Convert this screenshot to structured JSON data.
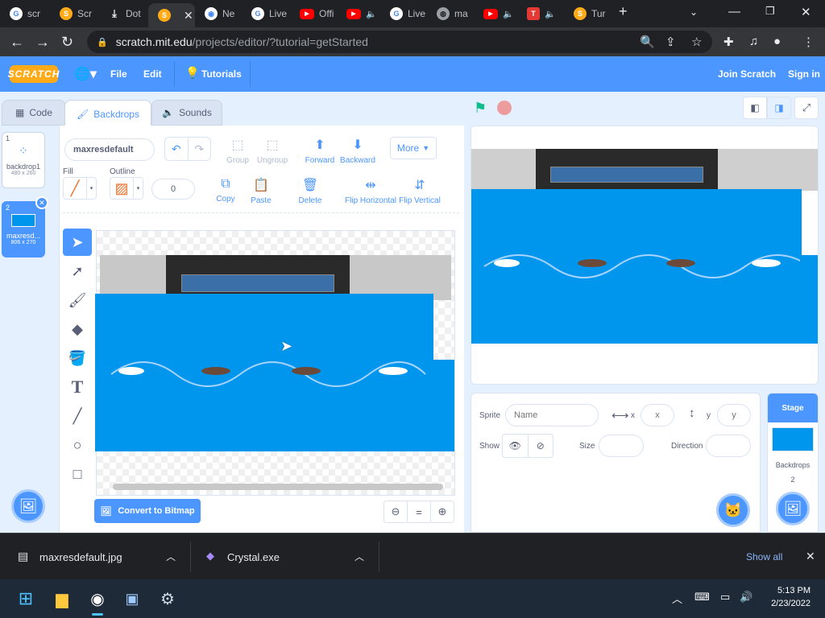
{
  "browser": {
    "tabs": [
      {
        "icon": "google-icon",
        "label": "scr"
      },
      {
        "icon": "scratch-icon",
        "label": "Scr"
      },
      {
        "icon": "download-icon",
        "label": "Dot"
      },
      {
        "icon": "scratch-icon",
        "label": "",
        "active": true
      },
      {
        "icon": "chrome-icon",
        "label": "Ne"
      },
      {
        "icon": "google-icon",
        "label": "Live"
      },
      {
        "icon": "youtube-icon",
        "label": "Offi"
      },
      {
        "icon": "youtube-icon",
        "label": ""
      },
      {
        "icon": "google-icon",
        "label": "Live"
      },
      {
        "icon": "globe-icon",
        "label": "ma"
      },
      {
        "icon": "youtube-icon",
        "label": ""
      },
      {
        "icon": "tool-icon",
        "label": ""
      },
      {
        "icon": "scratch-icon",
        "label": "Tur"
      }
    ],
    "url_host": "scratch.mit.edu",
    "url_path": "/projects/editor/?tutorial=getStarted"
  },
  "menu": {
    "logo": "SCRATCH",
    "file": "File",
    "edit": "Edit",
    "tutorials": "Tutorials",
    "join": "Join Scratch",
    "signin": "Sign in"
  },
  "editor_tabs": {
    "code": "Code",
    "backdrops": "Backdrops",
    "sounds": "Sounds"
  },
  "backdrops": [
    {
      "num": "1",
      "name": "backdrop1",
      "size": "480 x 260"
    },
    {
      "num": "2",
      "name": "maxresd...",
      "size": "806 x 270",
      "selected": true
    }
  ],
  "paint": {
    "costume_name": "maxresdefault",
    "fill_label": "Fill",
    "outline_label": "Outline",
    "outline_width": "0",
    "group": "Group",
    "ungroup": "Ungroup",
    "forward": "Forward",
    "backward": "Backward",
    "more": "More",
    "copy": "Copy",
    "paste": "Paste",
    "delete": "Delete",
    "flip_h": "Flip Horizontal",
    "flip_v": "Flip Vertical",
    "convert": "Convert to Bitmap"
  },
  "sprite_info": {
    "sprite_label": "Sprite",
    "name_placeholder": "Name",
    "x_label": "x",
    "x_placeholder": "x",
    "y_label": "y",
    "y_placeholder": "y",
    "show_label": "Show",
    "size_label": "Size",
    "direction_label": "Direction"
  },
  "stage_panel": {
    "title": "Stage",
    "backdrops_label": "Backdrops",
    "backdrops_count": "2"
  },
  "downloads": {
    "items": [
      {
        "icon": "file-icon",
        "name": "maxresdefault.jpg"
      },
      {
        "icon": "crystal-icon",
        "name": "Crystal.exe"
      }
    ],
    "show_all": "Show all"
  },
  "taskbar": {
    "time": "5:13 PM",
    "date": "2/23/2022"
  },
  "colors": {
    "scratch_blue": "#4c97ff",
    "wave_blue": "#0096ee",
    "chrome_dark": "#202124"
  }
}
